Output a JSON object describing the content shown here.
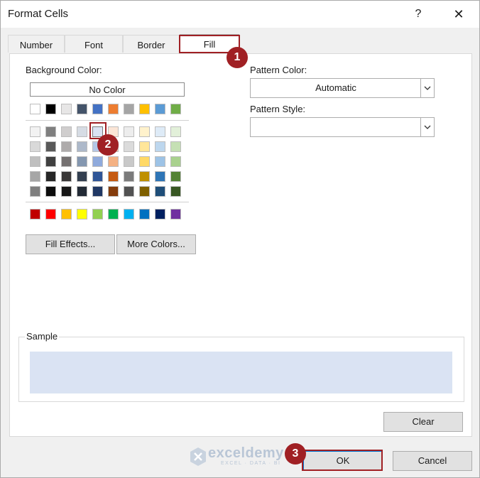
{
  "dialog": {
    "title": "Format Cells",
    "help": "?",
    "close": "✕"
  },
  "tabs": [
    {
      "label": "Number"
    },
    {
      "label": "Font"
    },
    {
      "label": "Border"
    },
    {
      "label": "Fill"
    }
  ],
  "fill": {
    "background_color_label": "Background Color:",
    "no_color": "No Color",
    "fill_effects": "Fill Effects...",
    "more_colors": "More Colors...",
    "pattern_color_label": "Pattern Color:",
    "pattern_color_value": "Automatic",
    "pattern_style_label": "Pattern Style:",
    "pattern_style_value": "",
    "selected_color": "#dae3f3"
  },
  "palette": {
    "theme_row": [
      "#ffffff",
      "#000000",
      "#e7e6e6",
      "#44546a",
      "#4472c4",
      "#ed7d31",
      "#a5a5a5",
      "#ffc000",
      "#5b9bd5",
      "#70ad47"
    ],
    "tint_rows": [
      [
        "#f2f2f2",
        "#7f7f7f",
        "#d0cece",
        "#d6dce4",
        "#dae3f3",
        "#fbe5d6",
        "#ededed",
        "#fff2cc",
        "#deebf7",
        "#e2f0d9"
      ],
      [
        "#d9d9d9",
        "#595959",
        "#aeabab",
        "#adb9ca",
        "#b4c7e7",
        "#f8cbad",
        "#dbdbdb",
        "#ffe699",
        "#bdd7ee",
        "#c5e0b4"
      ],
      [
        "#bfbfbf",
        "#404040",
        "#757171",
        "#8497b0",
        "#8faadc",
        "#f4b183",
        "#c9c9c9",
        "#ffd966",
        "#9dc3e6",
        "#a9d18e"
      ],
      [
        "#a6a6a6",
        "#262626",
        "#3a3838",
        "#333f50",
        "#2f5597",
        "#c55a11",
        "#7b7b7b",
        "#bf9000",
        "#2e75b6",
        "#548235"
      ],
      [
        "#7f7f7f",
        "#0d0d0d",
        "#171717",
        "#222a35",
        "#203864",
        "#843c0c",
        "#525252",
        "#7f6000",
        "#1f4e79",
        "#385723"
      ]
    ],
    "standard_row": [
      "#c00000",
      "#ff0000",
      "#ffc000",
      "#ffff00",
      "#92d050",
      "#00b050",
      "#00b0f0",
      "#0070c0",
      "#002060",
      "#7030a0"
    ]
  },
  "sample": {
    "label": "Sample"
  },
  "buttons": {
    "clear": "Clear",
    "ok": "OK",
    "cancel": "Cancel"
  },
  "annotations": {
    "step1": "1",
    "step2": "2",
    "step3": "3",
    "color": "#a02024"
  },
  "watermark": {
    "name": "exceldemy",
    "tagline": "EXCEL · DATA · BI"
  }
}
